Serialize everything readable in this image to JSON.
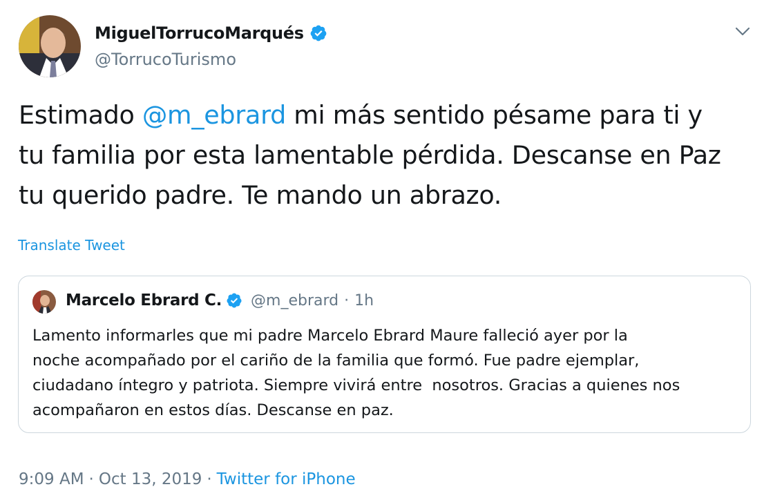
{
  "author": {
    "display_name": "MiguelTorrucoMarqués",
    "handle": "@TorrucoTurismo",
    "verified": true
  },
  "tweet": {
    "text_before": "Estimado ",
    "mention": "@m_ebrard",
    "text_after_line1": " mi más sentido pésame para ti y",
    "text_line2": "tu familia por esta lamentable pérdida. Descanse en Paz",
    "text_line3": "tu querido padre. Te mando un abrazo."
  },
  "translate_label": "Translate Tweet",
  "quoted_tweet": {
    "display_name": "Marcelo Ebrard C.",
    "handle": "@m_ebrard",
    "separator": "·",
    "time": "1h",
    "lines": [
      "Lamento informarles que mi padre Marcelo Ebrard Maure falleció ayer por la",
      "noche acompañado por el cariño de la familia que formó. Fue padre ejemplar,",
      "ciudadano íntegro y patriota. Siempre vivirá entre  nosotros. Gracias a quienes nos",
      "acompañaron en estos días. Descanse en paz."
    ]
  },
  "meta": {
    "time": "9:09 AM",
    "separator": "·",
    "date": "Oct 13, 2019",
    "source": "Twitter for iPhone"
  },
  "colors": {
    "accent": "#1b95e0",
    "text": "#14171a",
    "secondary": "#657786",
    "border": "#ccd6dd"
  },
  "icons": [
    "verified-badge-icon",
    "chevron-down-icon"
  ]
}
